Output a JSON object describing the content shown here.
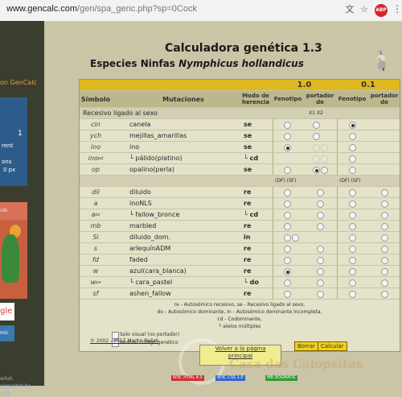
{
  "browser": {
    "url_domain": "www.gencalc.com",
    "url_path": "/gen/spa_genc.php?sp=0Cock",
    "abp_label": "ABP"
  },
  "sidebar": {
    "link": "on GenCalc",
    "panel_lines": [
      "1",
      "rent",
      "ons",
      "0 px"
    ],
    "ad_label": "rds",
    "google": "gle",
    "button": "mic",
    "footer": [
      "arket.",
      "y/gparket.be",
      ".net"
    ]
  },
  "header": {
    "title": "Calculadora genética 1.3",
    "subtitle_prefix": "Especies Ninfas ",
    "subtitle_species": "Nymphicus hollandicus"
  },
  "table": {
    "dose_labels": [
      "1.0",
      "0.1"
    ],
    "headers": {
      "symbol": "Símbolo",
      "mutations": "Mutaciones",
      "mode": "Modo de herencia",
      "phenotype": "Fenotipo",
      "carrier": "portador de"
    },
    "section_sex": "Recesivo ligado al sexo",
    "x_labels": "X1 X2",
    "sex_rows": [
      {
        "symbol": "cin",
        "name": "canela",
        "mode": "se"
      },
      {
        "symbol": "ych",
        "name": "mejillas_amarillas",
        "mode": "se"
      },
      {
        "symbol": "ino",
        "name": "ino",
        "mode": "se"
      },
      {
        "symbol": "ino^pd",
        "name": "└ pálido(platino)",
        "mode": "└ cd"
      },
      {
        "symbol": "op",
        "name": "opalino(perla)",
        "mode": "se"
      }
    ],
    "df_sf": "(DF) (SF)",
    "auto_rows": [
      {
        "symbol": "dil",
        "name": "diluido",
        "mode": "re"
      },
      {
        "symbol": "a",
        "name": "inoNLS",
        "mode": "re"
      },
      {
        "symbol": "a^bz",
        "name": "└ fallow_bronce",
        "mode": "└ cd"
      },
      {
        "symbol": "mb",
        "name": "marbled",
        "mode": "re"
      },
      {
        "symbol": "Si",
        "name": "diluido_dom.",
        "mode": "in"
      },
      {
        "symbol": "s",
        "name": "arlequínADM",
        "mode": "re"
      },
      {
        "symbol": "fd",
        "name": "faded",
        "mode": "re"
      },
      {
        "symbol": "w",
        "name": "azul(cara_blanca)",
        "mode": "re"
      },
      {
        "symbol": "w^pa",
        "name": "└ cara_pastel",
        "mode": "└ do"
      },
      {
        "symbol": "sf",
        "name": "ashen_fallow",
        "mode": "re"
      }
    ],
    "legend": {
      "line1": "re - Autosómico recesivo, se - Recesivo ligado al sexo,",
      "line2": "do - Autosómico dominante, in - Autosómico dominante incompleta,",
      "line3": "cd - Codominante,",
      "line4": "└ alelos múltiples"
    },
    "options": {
      "solo_visual": "Solo visual (no portador)",
      "mostrar_codigo": "Mostrar código genético"
    },
    "buttons": {
      "borrar": "Borrar",
      "calcular": "Calcular"
    }
  },
  "footer": {
    "copyright": "© 2002 - 2017 Martin Rašek",
    "back_line1": "Volver a la página",
    "back_line2": "principal",
    "watermark": "Casa das Calopsitas",
    "badges": [
      "W3C HTML 4.0",
      "W3C CSS 1.0",
      "MB DOGMATIC"
    ]
  }
}
